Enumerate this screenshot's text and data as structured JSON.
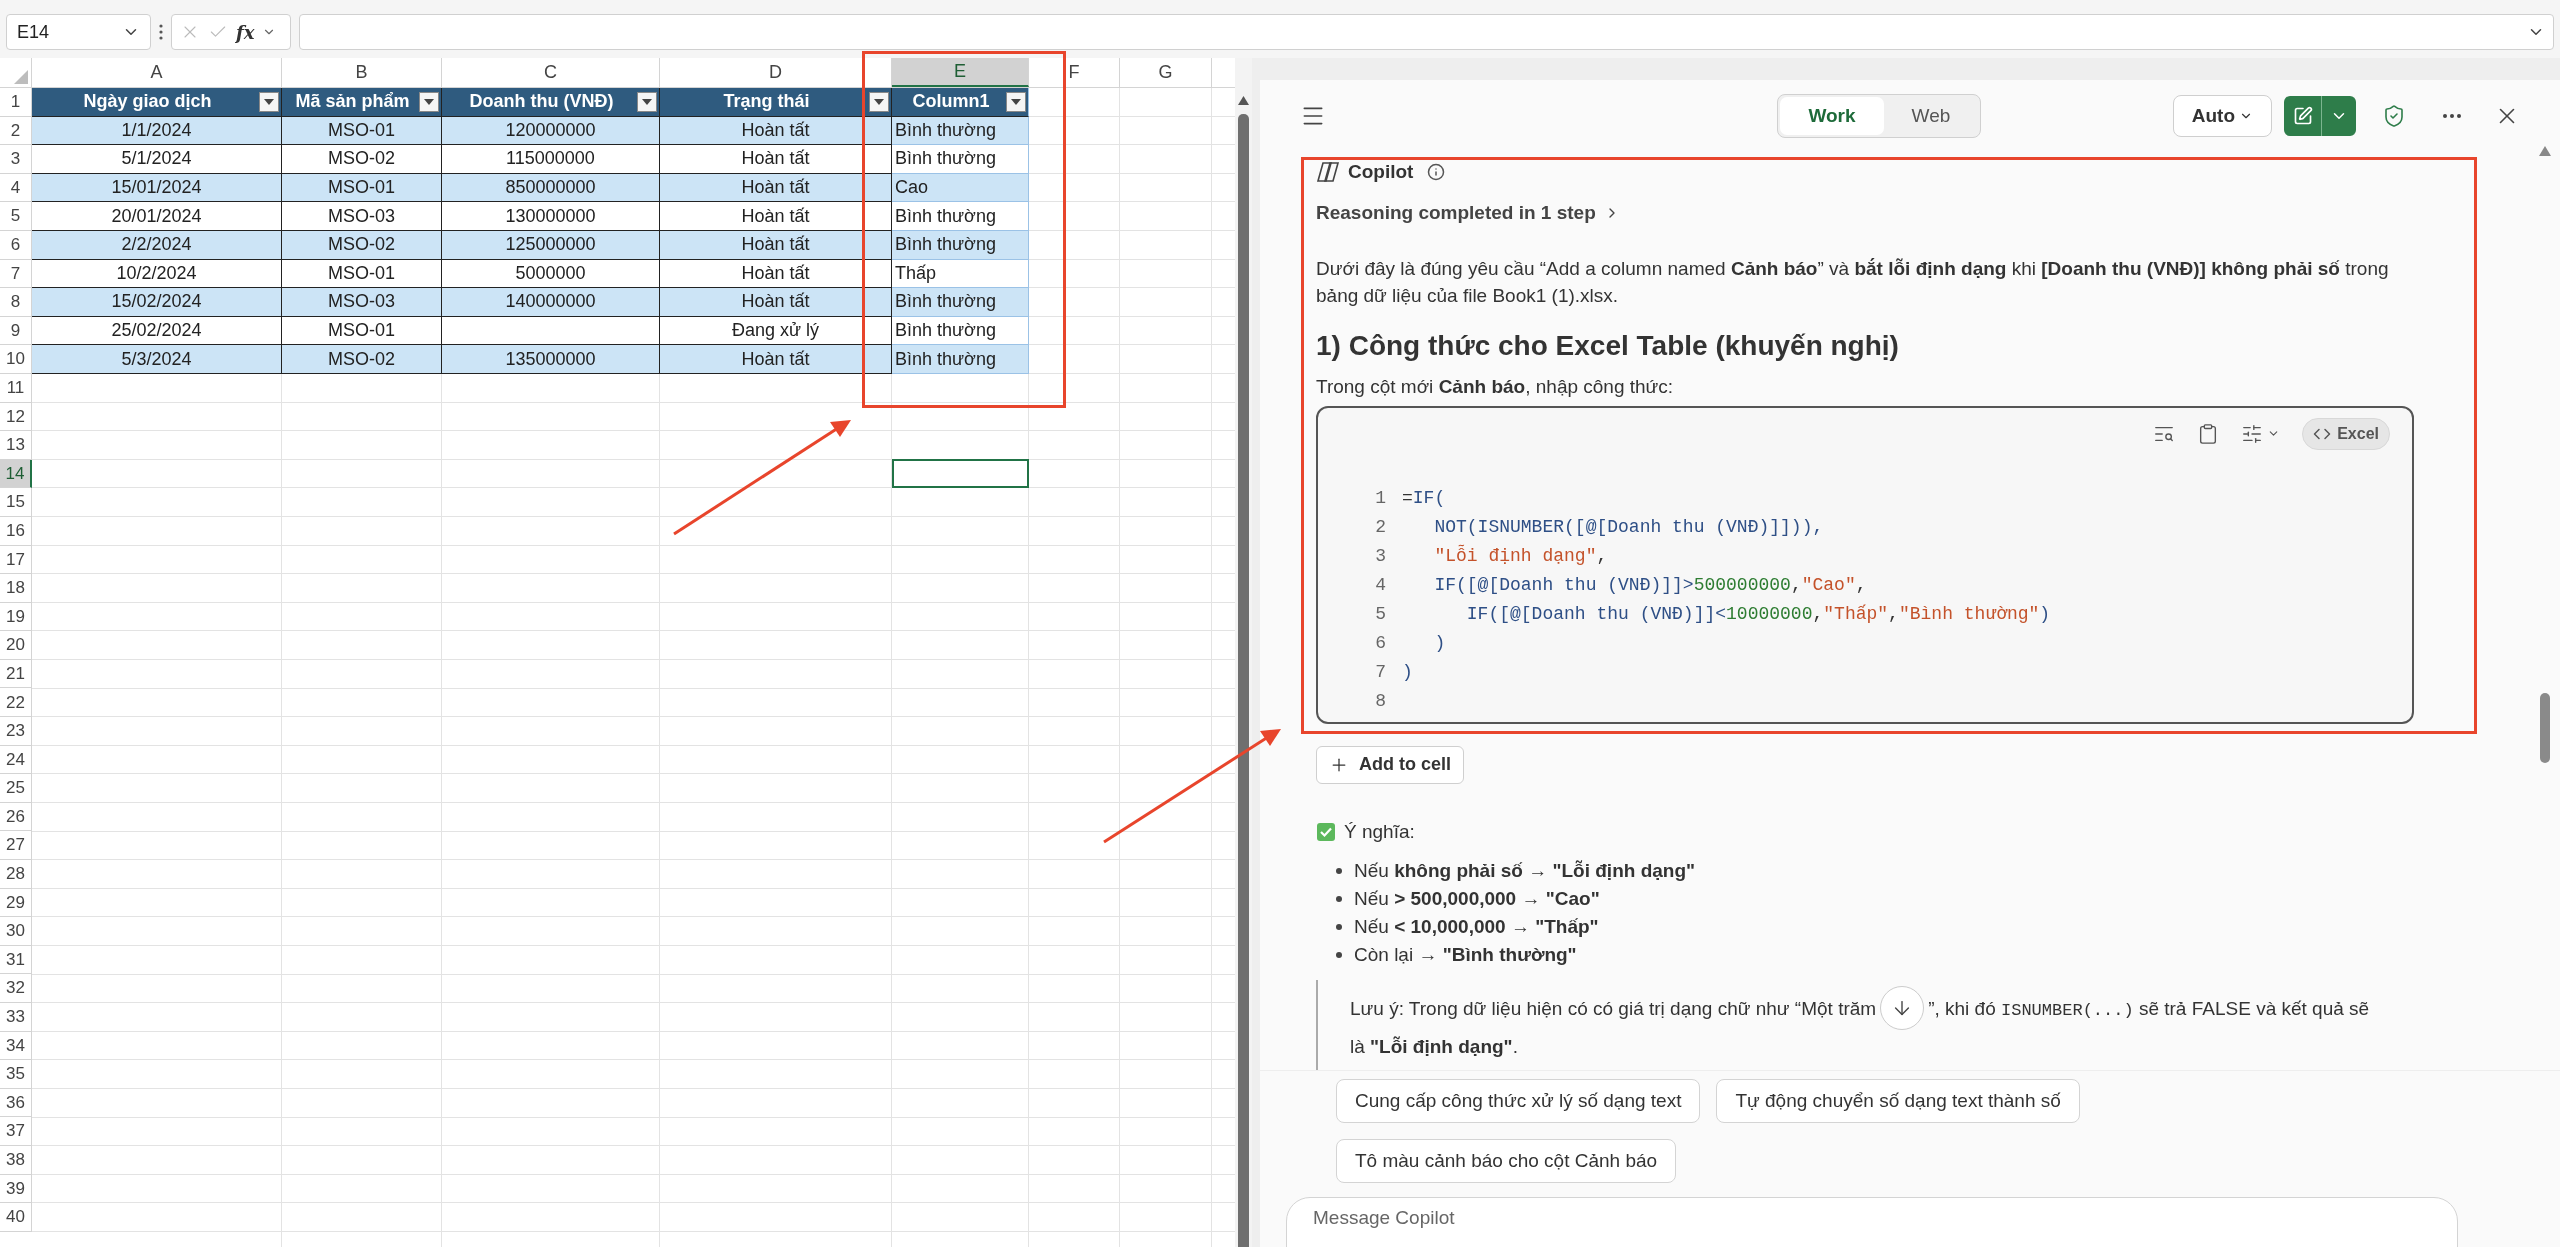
{
  "formula_bar": {
    "name_box": "E14",
    "fx": "fx"
  },
  "sheet": {
    "columns": [
      {
        "label": "A",
        "selected": false
      },
      {
        "label": "B",
        "selected": false
      },
      {
        "label": "C",
        "selected": false
      },
      {
        "label": "D",
        "selected": false
      },
      {
        "label": "E",
        "selected": true
      },
      {
        "label": "F",
        "selected": false
      },
      {
        "label": "G",
        "selected": false
      }
    ],
    "row_numbers": [
      {
        "label": "1",
        "selected": false
      },
      {
        "label": "2",
        "selected": false
      },
      {
        "label": "3",
        "selected": false
      },
      {
        "label": "4",
        "selected": false
      },
      {
        "label": "5",
        "selected": false
      },
      {
        "label": "6",
        "selected": false
      },
      {
        "label": "7",
        "selected": false
      },
      {
        "label": "8",
        "selected": false
      },
      {
        "label": "9",
        "selected": false
      },
      {
        "label": "10",
        "selected": false
      },
      {
        "label": "11",
        "selected": false
      },
      {
        "label": "12",
        "selected": false
      },
      {
        "label": "13",
        "selected": false
      },
      {
        "label": "14",
        "selected": true
      },
      {
        "label": "15",
        "selected": false
      },
      {
        "label": "16",
        "selected": false
      },
      {
        "label": "17",
        "selected": false
      },
      {
        "label": "18",
        "selected": false
      },
      {
        "label": "19",
        "selected": false
      },
      {
        "label": "20",
        "selected": false
      },
      {
        "label": "21",
        "selected": false
      },
      {
        "label": "22",
        "selected": false
      },
      {
        "label": "23",
        "selected": false
      },
      {
        "label": "24",
        "selected": false
      },
      {
        "label": "25",
        "selected": false
      },
      {
        "label": "26",
        "selected": false
      },
      {
        "label": "27",
        "selected": false
      },
      {
        "label": "28",
        "selected": false
      },
      {
        "label": "29",
        "selected": false
      },
      {
        "label": "30",
        "selected": false
      },
      {
        "label": "31",
        "selected": false
      },
      {
        "label": "32",
        "selected": false
      },
      {
        "label": "33",
        "selected": false
      },
      {
        "label": "34",
        "selected": false
      },
      {
        "label": "35",
        "selected": false
      },
      {
        "label": "36",
        "selected": false
      },
      {
        "label": "37",
        "selected": false
      },
      {
        "label": "38",
        "selected": false
      },
      {
        "label": "39",
        "selected": false
      },
      {
        "label": "40",
        "selected": false
      }
    ],
    "table": {
      "headers": [
        "Ngày giao dịch",
        "Mã sản phẩm",
        "Doanh thu (VNĐ)",
        "Trạng thái",
        "Column1"
      ],
      "rows": [
        [
          "1/1/2024",
          "MSO-01",
          "120000000",
          "Hoàn tất",
          "Bình thường"
        ],
        [
          "5/1/2024",
          "MSO-02",
          "115000000",
          "Hoàn tất",
          "Bình thường"
        ],
        [
          "15/01/2024",
          "MSO-01",
          "850000000",
          "Hoàn tất",
          "Cao"
        ],
        [
          "20/01/2024",
          "MSO-03",
          "130000000",
          "Hoàn tất",
          "Bình thường"
        ],
        [
          "2/2/2024",
          "MSO-02",
          "125000000",
          "Hoàn tất",
          "Bình thường"
        ],
        [
          "10/2/2024",
          "MSO-01",
          "5000000",
          "Hoàn tất",
          "Thấp"
        ],
        [
          "15/02/2024",
          "MSO-03",
          "140000000",
          "Hoàn tất",
          "Bình thường"
        ],
        [
          "25/02/2024",
          "MSO-01",
          "",
          "Đang xử lý",
          "Bình thường"
        ],
        [
          "5/3/2024",
          "MSO-02",
          "135000000",
          "Hoàn tất",
          "Bình thường"
        ]
      ]
    }
  },
  "copilot": {
    "tabs": [
      {
        "label": "Work",
        "selected": true
      },
      {
        "label": "Web",
        "selected": false
      }
    ],
    "mode": "Auto",
    "sender": "Copilot",
    "reasoning": "Reasoning completed in 1 step",
    "intro": "Dưới đây là đúng yêu cầu “Add a column named **Cảnh báo**” và **bắt lỗi định dạng** khi **[Doanh thu (VNĐ)] không phải số** trong bảng dữ liệu của file Book1 (1).xlsx.",
    "heading": "1) Công thức cho Excel Table (khuyến nghị)",
    "instruction": "Trong cột mới **Cảnh báo**, nhập công thức:",
    "code": {
      "language": "Excel",
      "lines": [
        {
          "number": "1",
          "segments": [
            {
              "kind": "op",
              "text": "="
            },
            {
              "kind": "func",
              "text": "IF("
            }
          ]
        },
        {
          "number": "2",
          "segments": [
            {
              "kind": "func",
              "text": "   NOT(ISNUMBER([@[Doanh thu (VNĐ)]])),"
            }
          ]
        },
        {
          "number": "3",
          "segments": [
            {
              "kind": "string",
              "text": "   \"Lỗi định dạng\""
            },
            {
              "kind": "op",
              "text": ","
            }
          ]
        },
        {
          "number": "4",
          "segments": [
            {
              "kind": "func",
              "text": "   IF([@[Doanh thu (VNĐ)]]>"
            },
            {
              "kind": "number",
              "text": "500000000"
            },
            {
              "kind": "op",
              "text": ","
            },
            {
              "kind": "string",
              "text": "\"Cao\""
            },
            {
              "kind": "op",
              "text": ","
            }
          ]
        },
        {
          "number": "5",
          "segments": [
            {
              "kind": "func",
              "text": "      IF([@[Doanh thu (VNĐ)]]<"
            },
            {
              "kind": "number",
              "text": "10000000"
            },
            {
              "kind": "op",
              "text": ","
            },
            {
              "kind": "string",
              "text": "\"Thấp\""
            },
            {
              "kind": "op",
              "text": ","
            },
            {
              "kind": "string",
              "text": "\"Bình thường\""
            },
            {
              "kind": "func",
              "text": ")"
            }
          ]
        },
        {
          "number": "6",
          "segments": [
            {
              "kind": "func",
              "text": "   )"
            }
          ]
        },
        {
          "number": "7",
          "segments": [
            {
              "kind": "func",
              "text": ")"
            }
          ]
        },
        {
          "number": "8"
        }
      ]
    },
    "add_button": "Add to cell",
    "meaning_title": "Ý nghĩa:",
    "bullets": [
      "Nếu **không phải số** → **\"Lỗi định dạng\"**",
      "Nếu **> 500,000,000** → **\"Cao\"**",
      "Nếu **< 10,000,000** → **\"Thấp\"**",
      "Còn lại → **\"Bình thường\"**"
    ],
    "note": {
      "before": "Lưu ý: Trong dữ liệu hiện có có giá trị dạng chữ như “Một trăm",
      "after": "”, khi đó ",
      "code": "ISNUMBER(...)",
      "rest": " sẽ trả FALSE và kết quả sẽ là **\"Lỗi định dạng\"**."
    },
    "suggestions": [
      "Cung cấp công thức xử lý số dạng text",
      "Tự động chuyển số dạng text thành số",
      "Tô màu cảnh báo cho cột Cảnh báo"
    ],
    "message_placeholder": "Message Copilot"
  }
}
